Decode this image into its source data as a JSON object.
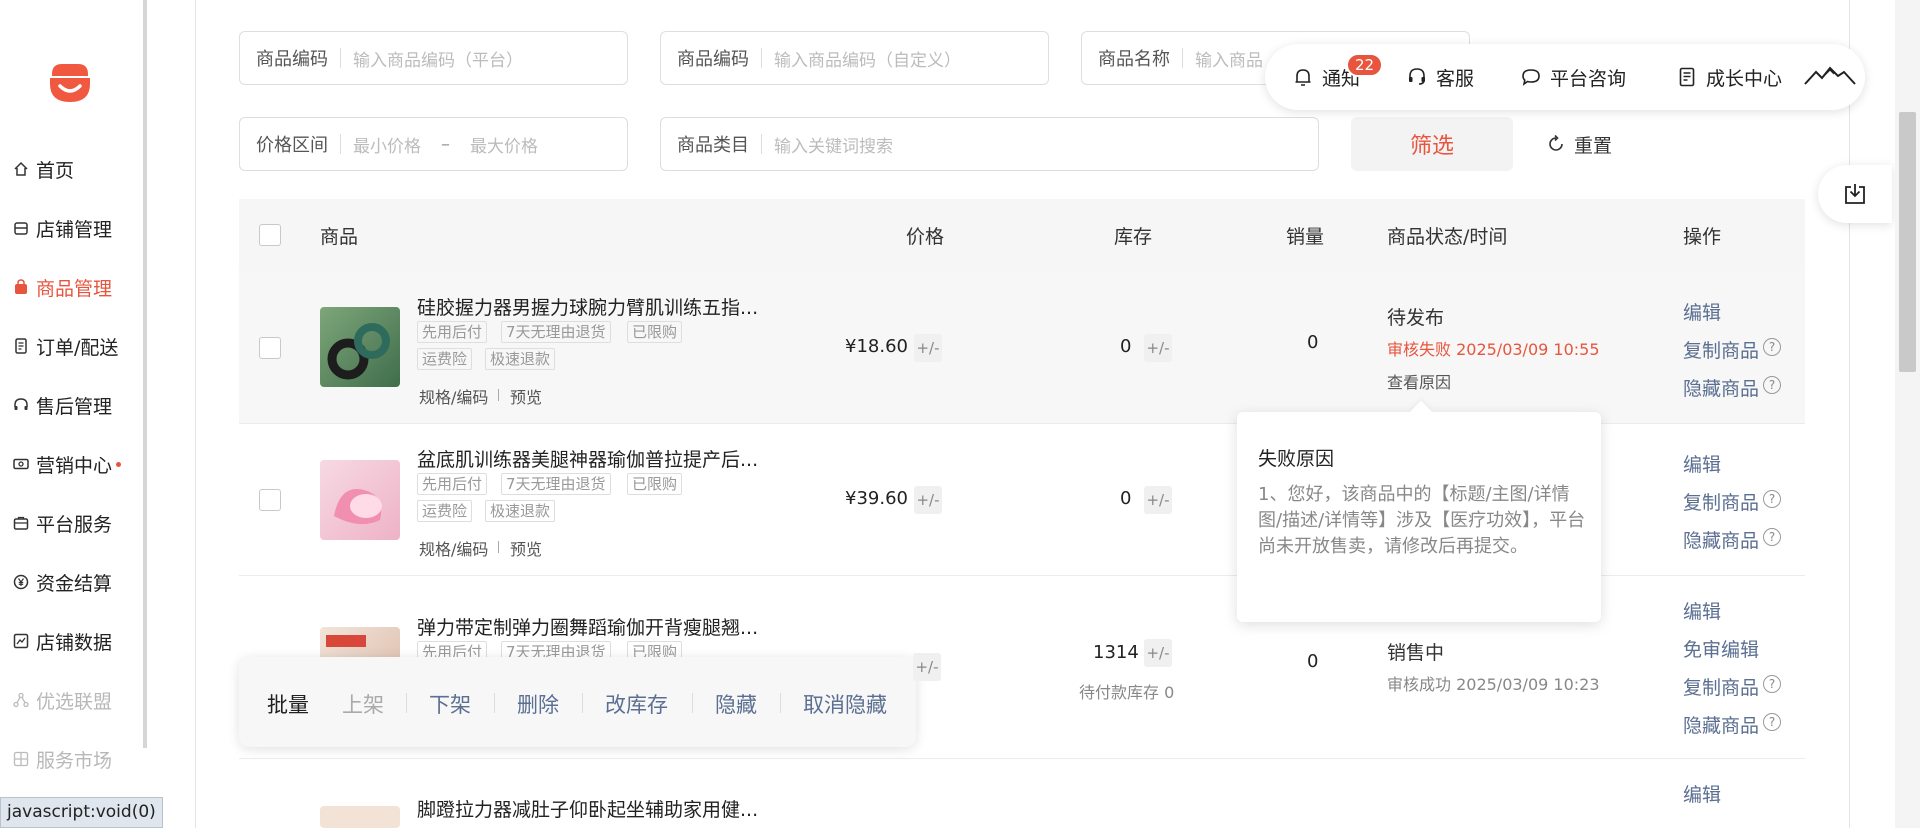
{
  "sidebar": {
    "items": [
      {
        "label": "首页",
        "icon": "home-icon"
      },
      {
        "label": "店铺管理",
        "icon": "shop-icon"
      },
      {
        "label": "商品管理",
        "icon": "bag-icon",
        "active": true
      },
      {
        "label": "订单/配送",
        "icon": "order-icon"
      },
      {
        "label": "售后管理",
        "icon": "headset-icon"
      },
      {
        "label": "营销中心",
        "icon": "ticket-icon",
        "dot": true
      },
      {
        "label": "平台服务",
        "icon": "briefcase-icon"
      },
      {
        "label": "资金结算",
        "icon": "yen-icon"
      },
      {
        "label": "店铺数据",
        "icon": "chart-icon"
      },
      {
        "label": "优选联盟",
        "icon": "network-icon",
        "dim": true
      },
      {
        "label": "服务市场",
        "icon": "grid-icon",
        "dim": true
      }
    ],
    "status_url": "javascript:void(0)"
  },
  "filters": {
    "code_platform": {
      "label": "商品编码",
      "placeholder": "输入商品编码（平台）"
    },
    "code_custom": {
      "label": "商品编码",
      "placeholder": "输入商品编码（自定义）"
    },
    "name": {
      "label": "商品名称",
      "placeholder": "输入商品"
    },
    "price_range": {
      "label": "价格区间",
      "min_placeholder": "最小价格",
      "dash": "–",
      "max_placeholder": "最大价格"
    },
    "category": {
      "label": "商品类目",
      "placeholder": "输入关键词搜索"
    },
    "filter_button": "筛选",
    "reset_button": "重置"
  },
  "topbar": {
    "notify": "通知",
    "notify_count": "22",
    "service": "客服",
    "consult": "平台咨询",
    "growth": "成长中心"
  },
  "table": {
    "headers": {
      "product": "商品",
      "price": "价格",
      "stock": "库存",
      "sales": "销量",
      "status": "商品状态/时间",
      "ops": "操作"
    },
    "rows": [
      {
        "title": "硅胶握力器男握力球腕力臂肌训练五指...",
        "tags_line1": [
          "先用后付",
          "7天无理由退货",
          "已限购"
        ],
        "tags_line2": [
          "运费险",
          "极速退款"
        ],
        "spec": "规格/编码",
        "preview": "预览",
        "price": "¥18.60",
        "stock": "0",
        "sales": "0",
        "status": "待发布",
        "status_sub": "审核失败 2025/03/09 10:55",
        "status_link": "查看原因",
        "ops": [
          "编辑",
          "复制商品",
          "隐藏商品"
        ]
      },
      {
        "title": "盆底肌训练器美腿神器瑜伽普拉提产后...",
        "tags_line1": [
          "先用后付",
          "7天无理由退货",
          "已限购"
        ],
        "tags_line2": [
          "运费险",
          "极速退款"
        ],
        "spec": "规格/编码",
        "preview": "预览",
        "price": "¥39.60",
        "stock": "0",
        "ops": [
          "编辑",
          "复制商品",
          "隐藏商品"
        ]
      },
      {
        "title": "弹力带定制弹力圈舞蹈瑜伽开背瘦腿翘...",
        "tags_line1": [
          "先用后付",
          "7天无理由退货",
          "已限购"
        ],
        "stock": "1314",
        "stock_sub": "待付款库存 0",
        "sales": "0",
        "status": "销售中",
        "status_sub": "审核成功 2025/03/09 10:23",
        "ops": [
          "编辑",
          "免审编辑",
          "复制商品",
          "隐藏商品"
        ]
      },
      {
        "title": "脚蹬拉力器减肚子仰卧起坐辅助家用健...",
        "ops": [
          "编辑"
        ]
      }
    ]
  },
  "popover": {
    "title": "失败原因",
    "body": "1、您好，该商品中的【标题/主图/详情图/描述/详情等】涉及【医疗功效】，平台尚未开放售卖，请修改后再提交。"
  },
  "batch": {
    "label": "批量",
    "actions": [
      "上架",
      "下架",
      "删除",
      "改库存",
      "隐藏",
      "取消隐藏"
    ]
  },
  "colors": {
    "accent": "#e8553e",
    "link": "#5b6f91"
  }
}
